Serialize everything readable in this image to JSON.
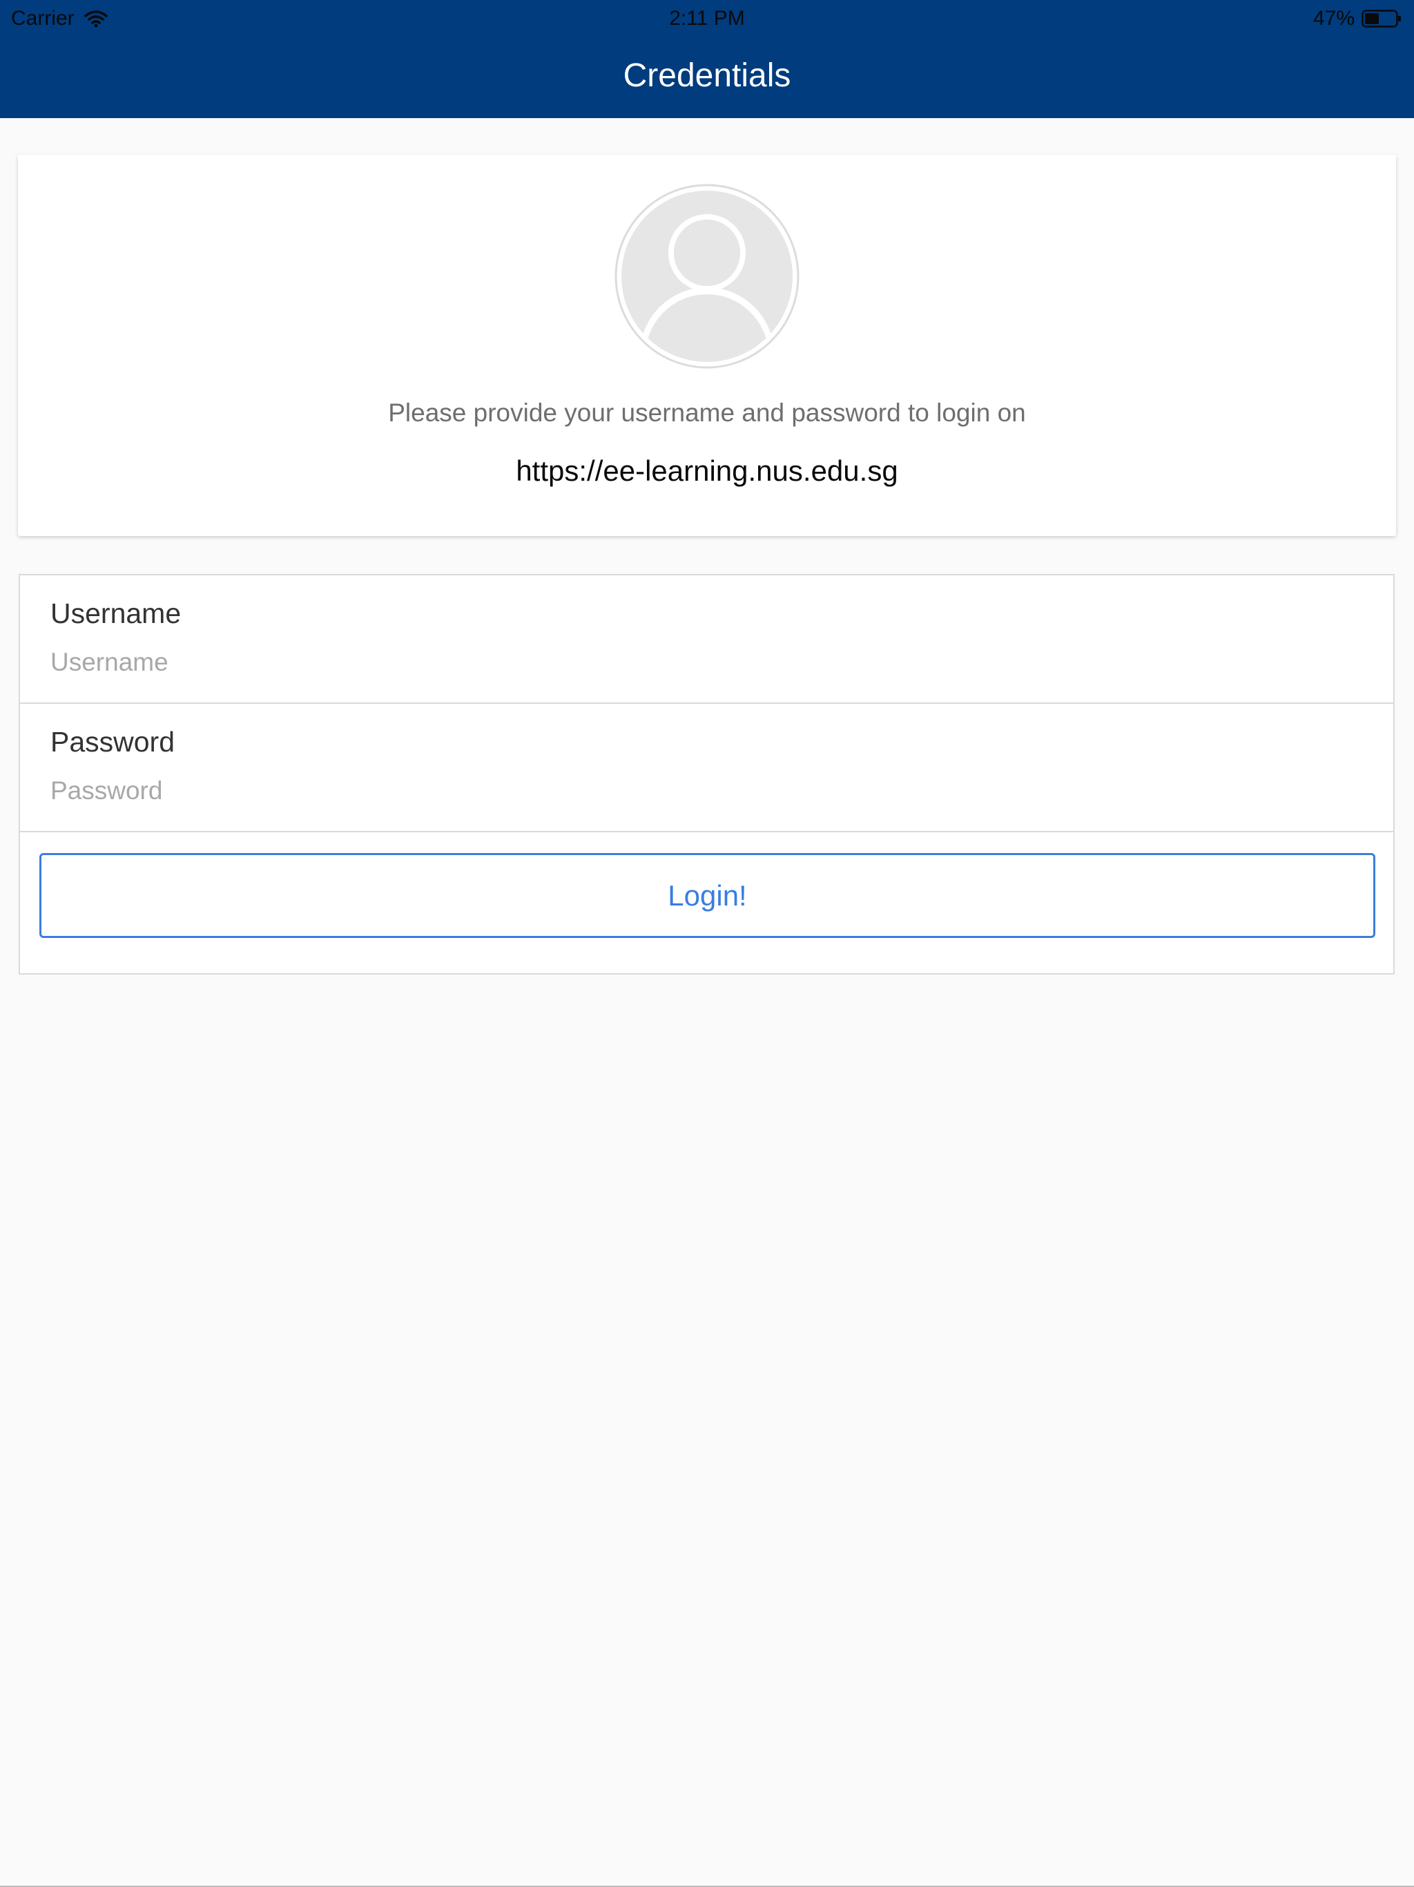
{
  "status_bar": {
    "carrier": "Carrier",
    "time": "2:11 PM",
    "battery_percent": "47%",
    "battery_level": 0.47,
    "wifi_icon": "wifi-icon",
    "battery_icon": "battery-icon"
  },
  "header": {
    "title": "Credentials",
    "background_color": "#003c7e"
  },
  "card": {
    "avatar_icon": "user-avatar-icon",
    "message": "Please provide your username and password to login on",
    "url": "https://ee-learning.nus.edu.sg"
  },
  "form": {
    "username": {
      "label": "Username",
      "placeholder": "Username",
      "value": ""
    },
    "password": {
      "label": "Password",
      "placeholder": "Password",
      "value": ""
    },
    "login_label": "Login!",
    "accent_color": "#3a7de0"
  }
}
